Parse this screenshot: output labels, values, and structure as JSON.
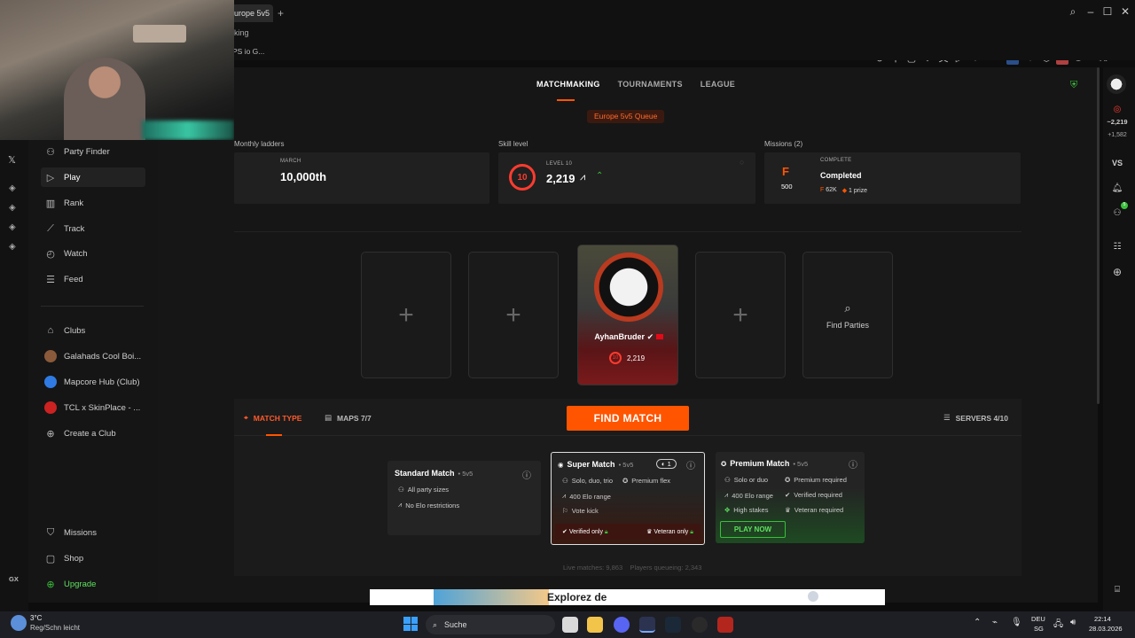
{
  "browser": {
    "tab_title": "urope 5v5",
    "address_text": "king",
    "bookmark_text": "PS io G..."
  },
  "sidebar": {
    "items": [
      {
        "label": "Party Finder",
        "icon": "party-icon"
      },
      {
        "label": "Play",
        "icon": "play-icon"
      },
      {
        "label": "Rank",
        "icon": "rank-icon"
      },
      {
        "label": "Track",
        "icon": "track-icon"
      },
      {
        "label": "Watch",
        "icon": "watch-icon"
      },
      {
        "label": "Feed",
        "icon": "feed-icon"
      }
    ],
    "clubs": [
      {
        "label": "Clubs",
        "icon": "clubs-icon"
      },
      {
        "label": "Galahads Cool Boi...",
        "color": "#8a5a3a"
      },
      {
        "label": "Mapcore Hub (Club)",
        "color": "#2f7be3"
      },
      {
        "label": "TCL x SkinPlace - ...",
        "color": "#cc2222"
      },
      {
        "label": "Create a Club",
        "icon": "plus-circle-icon"
      }
    ],
    "bottom": [
      {
        "label": "Missions"
      },
      {
        "label": "Shop"
      },
      {
        "label": "Upgrade",
        "color": "#39c03b"
      }
    ],
    "gx_label": "GX"
  },
  "topnav": {
    "tabs": [
      "MATCHMAKING",
      "TOURNAMENTS",
      "LEAGUE"
    ],
    "queue": "Europe 5v5 Queue"
  },
  "stats": {
    "ladders_label": "Monthly ladders",
    "ladders_month": "MARCH",
    "ladders_value": "10,000th",
    "skill_label": "Skill level",
    "skill_level_text": "LEVEL 10",
    "skill_level_num": "10",
    "skill_elo": "2,219",
    "missions_label": "Missions (2)",
    "missions_status": "COMPLETE",
    "missions_title": "Completed",
    "missions_points": "500",
    "missions_coins": "62K",
    "missions_prize": "1 prize"
  },
  "lobby": {
    "player_name": "AyhanBruder",
    "player_level": "10",
    "player_elo": "2,219",
    "find_parties": "Find Parties"
  },
  "matchbar": {
    "match_type": "MATCH TYPE",
    "maps": "MAPS 7/7",
    "find_match": "FIND MATCH",
    "servers": "SERVERS 4/10"
  },
  "modes": {
    "standard": {
      "title": "Standard Match",
      "suffix": "• 5v5",
      "r1": "All party sizes",
      "r2": "No Elo restrictions"
    },
    "super": {
      "title": "Super Match",
      "suffix": "• 5v5",
      "badge": "1",
      "r1": "Solo, duo, trio",
      "r1b": "Premium flex",
      "r2": "400 Elo range",
      "r3": "Vote kick",
      "v1": "Verified only",
      "v2": "Veteran only"
    },
    "premium": {
      "title": "Premium Match",
      "suffix": "• 5v5",
      "r1": "Solo or duo",
      "r1b": "Premium required",
      "r2": "400 Elo range",
      "r2b": "Verified required",
      "r3": "High stakes",
      "r3b": "Veteran required",
      "cta": "PLAY NOW"
    }
  },
  "footer": {
    "live": "Live matches: 9,863",
    "queue": "Players queueing: 2,343",
    "ad_text": "Explorez de"
  },
  "rightbar": {
    "elo": "~2,219",
    "delta": "+1,582",
    "vs": "VS",
    "friends_badge": "5"
  },
  "taskbar": {
    "weather_temp": "3°C",
    "weather_desc": "Reg/Schn leicht",
    "search": "Suche",
    "lang1": "DEU",
    "lang2": "SG",
    "time": "22:14",
    "date": "28.03.2026"
  }
}
